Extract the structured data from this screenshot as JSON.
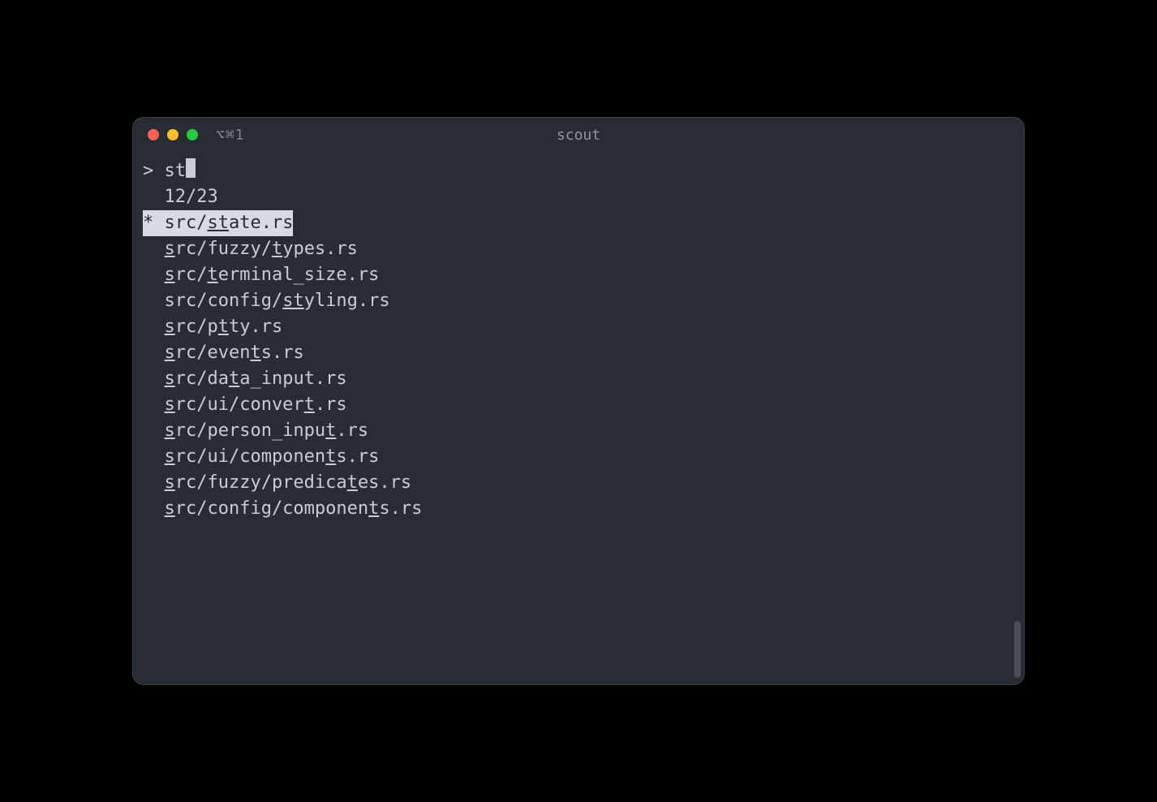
{
  "window": {
    "title": "scout",
    "shortcut_hint": "⌥⌘1"
  },
  "prompt": {
    "symbol": ">",
    "query": "st"
  },
  "counter": {
    "shown": 12,
    "total": 23,
    "text": "12/23"
  },
  "results": [
    {
      "selected": true,
      "marker": "*",
      "text": "src/state.rs",
      "segments": [
        {
          "t": "src/",
          "u": false
        },
        {
          "t": "st",
          "u": true
        },
        {
          "t": "ate.rs",
          "u": false
        }
      ]
    },
    {
      "selected": false,
      "marker": "",
      "text": "src/fuzzy/types.rs",
      "segments": [
        {
          "t": "s",
          "u": true
        },
        {
          "t": "rc/fuzzy/",
          "u": false
        },
        {
          "t": "t",
          "u": true
        },
        {
          "t": "ypes.rs",
          "u": false
        }
      ]
    },
    {
      "selected": false,
      "marker": "",
      "text": "src/terminal_size.rs",
      "segments": [
        {
          "t": "s",
          "u": true
        },
        {
          "t": "rc/",
          "u": false
        },
        {
          "t": "t",
          "u": true
        },
        {
          "t": "erminal_size.rs",
          "u": false
        }
      ]
    },
    {
      "selected": false,
      "marker": "",
      "text": "src/config/styling.rs",
      "segments": [
        {
          "t": "src/config/",
          "u": false
        },
        {
          "t": "st",
          "u": true
        },
        {
          "t": "yling.rs",
          "u": false
        }
      ]
    },
    {
      "selected": false,
      "marker": "",
      "text": "src/ptty.rs",
      "segments": [
        {
          "t": "s",
          "u": true
        },
        {
          "t": "rc/p",
          "u": false
        },
        {
          "t": "t",
          "u": true
        },
        {
          "t": "ty.rs",
          "u": false
        }
      ]
    },
    {
      "selected": false,
      "marker": "",
      "text": "src/events.rs",
      "segments": [
        {
          "t": "s",
          "u": true
        },
        {
          "t": "rc/even",
          "u": false
        },
        {
          "t": "t",
          "u": true
        },
        {
          "t": "s.rs",
          "u": false
        }
      ]
    },
    {
      "selected": false,
      "marker": "",
      "text": "src/data_input.rs",
      "segments": [
        {
          "t": "s",
          "u": true
        },
        {
          "t": "rc/da",
          "u": false
        },
        {
          "t": "t",
          "u": true
        },
        {
          "t": "a_input.rs",
          "u": false
        }
      ]
    },
    {
      "selected": false,
      "marker": "",
      "text": "src/ui/convert.rs",
      "segments": [
        {
          "t": "s",
          "u": true
        },
        {
          "t": "rc/ui/conver",
          "u": false
        },
        {
          "t": "t",
          "u": true
        },
        {
          "t": ".rs",
          "u": false
        }
      ]
    },
    {
      "selected": false,
      "marker": "",
      "text": "src/person_input.rs",
      "segments": [
        {
          "t": "s",
          "u": true
        },
        {
          "t": "rc/person_inpu",
          "u": false
        },
        {
          "t": "t",
          "u": true
        },
        {
          "t": ".rs",
          "u": false
        }
      ]
    },
    {
      "selected": false,
      "marker": "",
      "text": "src/ui/components.rs",
      "segments": [
        {
          "t": "s",
          "u": true
        },
        {
          "t": "rc/ui/componen",
          "u": false
        },
        {
          "t": "t",
          "u": true
        },
        {
          "t": "s.rs",
          "u": false
        }
      ]
    },
    {
      "selected": false,
      "marker": "",
      "text": "src/fuzzy/predicates.rs",
      "segments": [
        {
          "t": "s",
          "u": true
        },
        {
          "t": "rc/fuzzy/predica",
          "u": false
        },
        {
          "t": "t",
          "u": true
        },
        {
          "t": "es.rs",
          "u": false
        }
      ]
    },
    {
      "selected": false,
      "marker": "",
      "text": "src/config/components.rs",
      "segments": [
        {
          "t": "s",
          "u": true
        },
        {
          "t": "rc/config/componen",
          "u": false
        },
        {
          "t": "t",
          "u": true
        },
        {
          "t": "s.rs",
          "u": false
        }
      ]
    }
  ]
}
